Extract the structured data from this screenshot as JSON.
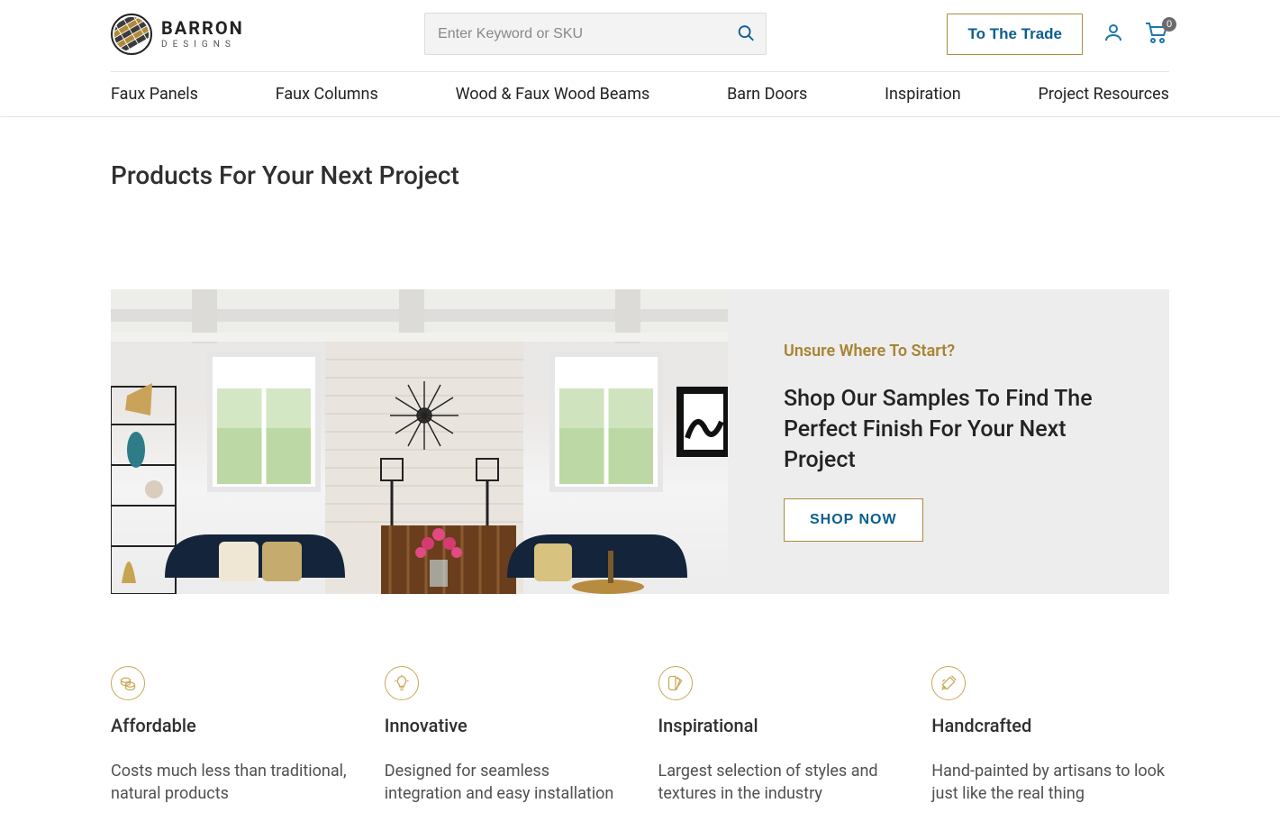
{
  "header": {
    "brand": "BARRON",
    "brand_sub": "DESIGNS",
    "search_placeholder": "Enter Keyword or SKU",
    "trade_btn": "To The Trade",
    "cart_count": "0"
  },
  "nav": {
    "items": [
      "Faux Panels",
      "Faux Columns",
      "Wood & Faux Wood Beams",
      "Barn Doors",
      "Inspiration",
      "Project Resources"
    ]
  },
  "page": {
    "title": "Products For Your Next Project"
  },
  "banner": {
    "eyebrow": "Unsure Where To Start?",
    "heading": "Shop Our Samples To Find The Perfect Finish For Your Next Project",
    "cta": "SHOP NOW"
  },
  "features": [
    {
      "title": "Affordable",
      "desc": "Costs much less than traditional, natural products"
    },
    {
      "title": "Innovative",
      "desc": "Designed for seamless integration and easy installation"
    },
    {
      "title": "Inspirational",
      "desc": "Largest selection of styles and textures in the industry"
    },
    {
      "title": "Handcrafted",
      "desc": "Hand-painted by artisans to look just like the real thing"
    }
  ],
  "colors": {
    "accent": "#a98c3f",
    "link": "#0b5e8f"
  }
}
